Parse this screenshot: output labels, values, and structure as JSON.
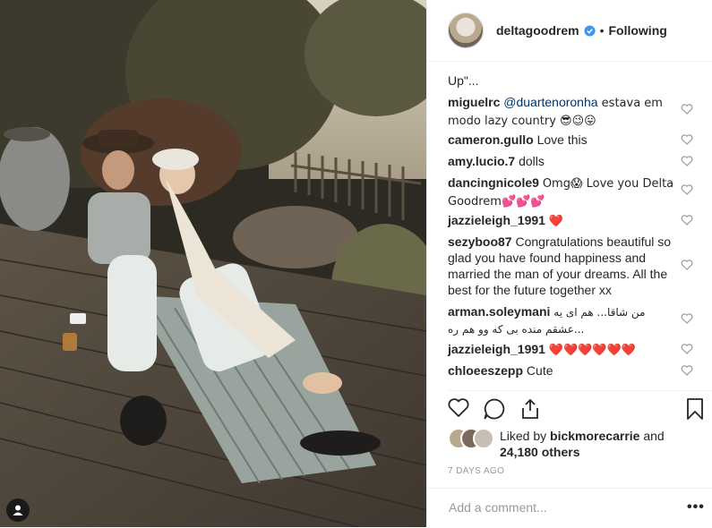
{
  "post": {
    "username": "deltagoodrem",
    "separator": "•",
    "follow_status": "Following"
  },
  "comments_cutoff": "Up\"...",
  "comments": [
    {
      "user": "miguelrc",
      "mention": "@duartenoronha",
      "text": " estava em modo lazy country 😎😉😛"
    },
    {
      "user": "cameron.gullo",
      "text": "Love this"
    },
    {
      "user": "amy.lucio.7",
      "text": "dolls"
    },
    {
      "user": "dancingnicole9",
      "text": "Omg😱 Love you Delta Goodrem💕💕💕"
    },
    {
      "user": "jazzieleigh_1991",
      "text": "❤️"
    },
    {
      "user": "sezyboo87",
      "text": "Congratulations beautiful so glad you have found happiness and married the man of your dreams. All the best for the future together xx"
    },
    {
      "user": "arman.soleymani",
      "text": "من شاقا... هم ای یه عشقم منده بی که وو هم ره..."
    },
    {
      "user": "jazzieleigh_1991",
      "text": "❤️❤️❤️❤️❤️❤️"
    },
    {
      "user": "chloeeszepp",
      "text": "Cute"
    }
  ],
  "likes": {
    "prefix": "Liked by ",
    "user": "bickmorecarrie",
    "middle": " and",
    "count_text": "24,180 others"
  },
  "timestamp": "7 DAYS AGO",
  "add_comment_placeholder": "Add a comment...",
  "more_label": "•••",
  "colors": {
    "verified_blue": "#3897f0",
    "heart_red": "#ed4956",
    "mention_blue": "#003569",
    "muted": "#999999"
  },
  "icons": [
    "user-tag-icon",
    "verified-icon",
    "heart-icon",
    "comment-icon",
    "share-icon",
    "bookmark-icon"
  ]
}
